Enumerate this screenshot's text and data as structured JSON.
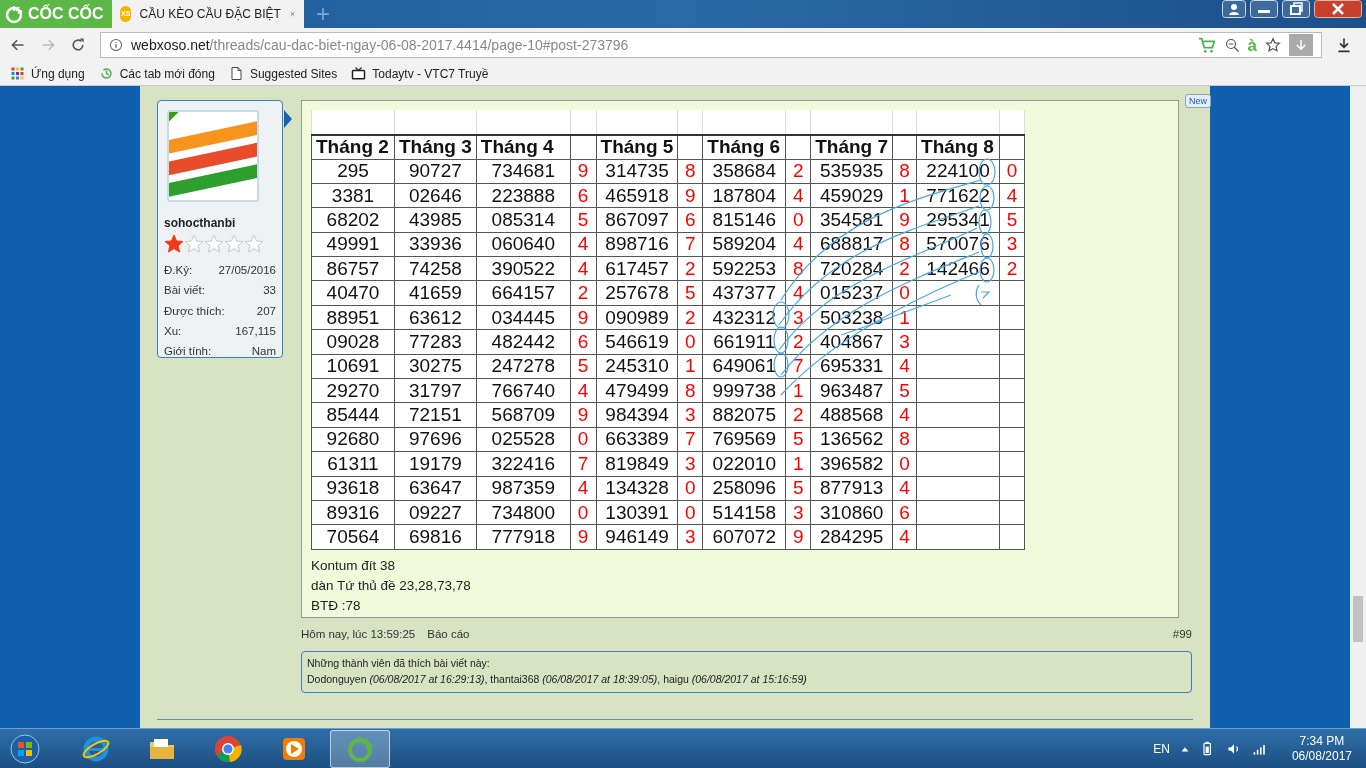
{
  "browser": {
    "brand": "CỐC CỐC",
    "tab": {
      "badge": "XS",
      "title": "CẦU KÈO CẦU ĐẶC BIỆT",
      "selected": true
    },
    "new_tab": "+",
    "address": {
      "domain": "webxoso.net",
      "path": "/threads/cau-dac-biet-ngay-06-08-2017.4414/page-10#post-273796"
    },
    "ime_indicator": "à",
    "bookmarks": [
      {
        "kind": "apps",
        "label": "Ứng dụng"
      },
      {
        "kind": "history",
        "label": "Các tab mới đóng"
      },
      {
        "kind": "page",
        "label": "Suggested Sites"
      },
      {
        "kind": "tv",
        "label": "Todaytv - VTC7 Truyề"
      }
    ]
  },
  "post": {
    "new_badge": "New",
    "user": {
      "name": "sohocthanbi",
      "stars": 1,
      "stats": [
        {
          "label": "Đ.Ký:",
          "value": "27/05/2016"
        },
        {
          "label": "Bài viết:",
          "value": "33"
        },
        {
          "label": "Được thích:",
          "value": "207"
        },
        {
          "label": "Xu:",
          "value": "167,115"
        },
        {
          "label": "Giới tính:",
          "value": "Nam"
        }
      ]
    },
    "table": {
      "columns": [
        {
          "kind": "number",
          "label": "Tháng 2"
        },
        {
          "kind": "number",
          "label": "Tháng 3"
        },
        {
          "kind": "number",
          "label": "Tháng 4"
        },
        {
          "kind": "digit"
        },
        {
          "kind": "number",
          "label": "Tháng 5"
        },
        {
          "kind": "digit"
        },
        {
          "kind": "number",
          "label": "Tháng 6"
        },
        {
          "kind": "digit"
        },
        {
          "kind": "number",
          "label": "Tháng 7"
        },
        {
          "kind": "digit"
        },
        {
          "kind": "number",
          "label": "Tháng 8"
        },
        {
          "kind": "digit"
        }
      ],
      "rows": [
        [
          "295",
          "90727",
          "734681",
          "9",
          "314735",
          "8",
          "358684",
          "2",
          "535935",
          "8",
          "224100",
          "0"
        ],
        [
          "3381",
          "02646",
          "223888",
          "6",
          "465918",
          "9",
          "187804",
          "4",
          "459029",
          "1",
          "771622",
          "4"
        ],
        [
          "68202",
          "43985",
          "085314",
          "5",
          "867097",
          "6",
          "815146",
          "0",
          "354581",
          "9",
          "295341",
          "5"
        ],
        [
          "49991",
          "33936",
          "060640",
          "4",
          "898716",
          "7",
          "589204",
          "4",
          "688817",
          "8",
          "570076",
          "3"
        ],
        [
          "86757",
          "74258",
          "390522",
          "4",
          "617457",
          "2",
          "592253",
          "8",
          "720284",
          "2",
          "142466",
          "2"
        ],
        [
          "40470",
          "41659",
          "664157",
          "2",
          "257678",
          "5",
          "437377",
          "4",
          "015237",
          "0"
        ],
        [
          "88951",
          "63612",
          "034445",
          "9",
          "090989",
          "2",
          "432312",
          "3",
          "503238",
          "1"
        ],
        [
          "09028",
          "77283",
          "482442",
          "6",
          "546619",
          "0",
          "661911",
          "2",
          "404867",
          "3"
        ],
        [
          "10691",
          "30275",
          "247278",
          "5",
          "245310",
          "1",
          "649061",
          "7",
          "695331",
          "4"
        ],
        [
          "29270",
          "31797",
          "766740",
          "4",
          "479499",
          "8",
          "999738",
          "1",
          "963487",
          "5"
        ],
        [
          "85444",
          "72151",
          "568709",
          "9",
          "984394",
          "3",
          "882075",
          "2",
          "488568",
          "4"
        ],
        [
          "92680",
          "97696",
          "025528",
          "0",
          "663389",
          "7",
          "769569",
          "5",
          "136562",
          "8"
        ],
        [
          "61311",
          "19179",
          "322416",
          "7",
          "819849",
          "3",
          "022010",
          "1",
          "396582",
          "0"
        ],
        [
          "93618",
          "63647",
          "987359",
          "4",
          "134328",
          "0",
          "258096",
          "5",
          "877913",
          "4"
        ],
        [
          "89316",
          "09227",
          "734800",
          "0",
          "130391",
          "0",
          "514158",
          "3",
          "310860",
          "6"
        ],
        [
          "70564",
          "69816",
          "777918",
          "9",
          "946149",
          "3",
          "607072",
          "9",
          "284295",
          "4"
        ]
      ]
    },
    "message": [
      "Kontum đít 38",
      "dàn Tứ thủ đề 23,28,73,78",
      "BTĐ :78"
    ],
    "footer": {
      "time": "Hôm nay, lúc 13:59:25",
      "report": "Báo cáo",
      "number": "#99"
    },
    "likes": {
      "heading": "Những thành viên đã thích bài viết này:",
      "text": "Dodonguyen *(06/08/2017 at 16:29:13)*, thantai368 *(06/08/2017 at 18:39:05)*, haigu *(06/08/2017 at 15:16:59)*"
    }
  },
  "taskbar": {
    "apps": [
      {
        "kind": "ie",
        "selected": false
      },
      {
        "kind": "folder",
        "selected": false
      },
      {
        "kind": "chrome",
        "selected": false
      },
      {
        "kind": "player",
        "selected": false
      },
      {
        "kind": "coccoc",
        "selected": true
      }
    ],
    "language": "EN",
    "time": "7:34 PM",
    "date": "06/08/2017"
  }
}
